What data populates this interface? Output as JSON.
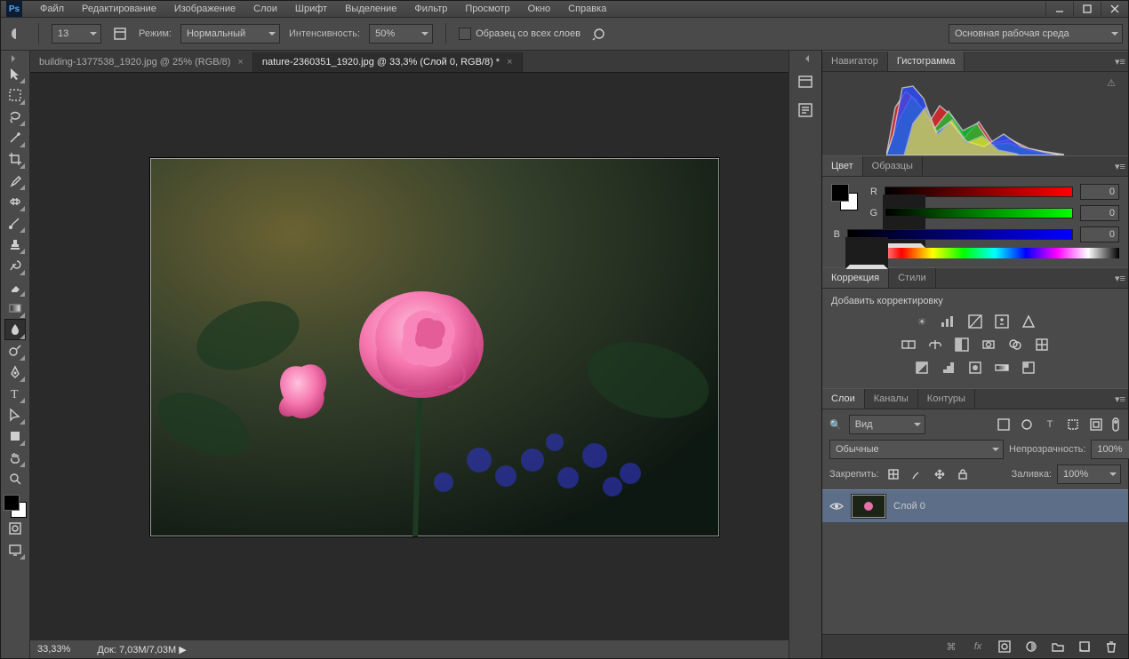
{
  "menu": [
    "Файл",
    "Редактирование",
    "Изображение",
    "Слои",
    "Шрифт",
    "Выделение",
    "Фильтр",
    "Просмотр",
    "Окно",
    "Справка"
  ],
  "options": {
    "brush_size": "13",
    "mode_label": "Режим:",
    "mode_value": "Нормальный",
    "intensity_label": "Интенсивность:",
    "intensity_value": "50%",
    "sample_all_label": "Образец со всех слоев",
    "workspace": "Основная рабочая среда"
  },
  "tabs": [
    {
      "label": "building-1377538_1920.jpg @ 25% (RGB/8)",
      "active": false
    },
    {
      "label": "nature-2360351_1920.jpg @ 33,3% (Слой 0, RGB/8) *",
      "active": true
    }
  ],
  "status": {
    "zoom": "33,33%",
    "doc_label": "Док:",
    "doc_value": "7,03M/7,03M"
  },
  "panels": {
    "nav": {
      "tabs": [
        "Навигатор",
        "Гистограмма"
      ],
      "active": 1
    },
    "color": {
      "tabs": [
        "Цвет",
        "Образцы"
      ],
      "active": 0,
      "channels": [
        {
          "n": "R",
          "v": "0"
        },
        {
          "n": "G",
          "v": "0"
        },
        {
          "n": "B",
          "v": "0"
        }
      ]
    },
    "adjust": {
      "tabs": [
        "Коррекция",
        "Стили"
      ],
      "active": 0,
      "hint": "Добавить корректировку"
    },
    "layers": {
      "tabs": [
        "Слои",
        "Каналы",
        "Контуры"
      ],
      "active": 0,
      "filter": "Вид",
      "blend": "Обычные",
      "opacity_label": "Непрозрачность:",
      "opacity": "100%",
      "lock_label": "Закрепить:",
      "fill_label": "Заливка:",
      "fill": "100%",
      "items": [
        {
          "name": "Слой 0"
        }
      ]
    }
  }
}
